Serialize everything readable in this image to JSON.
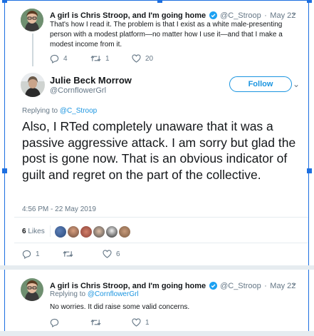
{
  "colors": {
    "accent": "#1b95e0",
    "verified": "#1da1f2",
    "selection": "#1d6fe0"
  },
  "tweet1": {
    "author": "A girl is Chris Stroop, and I'm going home",
    "handle": "@C_Stroop",
    "date": "May 22",
    "text": "That's how I read it. The problem is that I exist as a white male-presenting person with a modest platform—no matter how I use it—and that I make a modest income from it.",
    "replies": "4",
    "retweets": "1",
    "likes": "20"
  },
  "main": {
    "author": "Julie Beck Morrow",
    "handle": "@CornflowerGrl",
    "follow_label": "Follow",
    "replying_prefix": "Replying to",
    "replying_to": "@C_Stroop",
    "text": "Also, I RTed completely unaware that it was a passive aggressive attack. I am sorry but glad the post is gone now. That is an obvious indicator of guilt and regret on the part of the collective.",
    "timestamp": "4:56 PM - 22 May 2019",
    "likes_count": "6",
    "likes_label": "Likes",
    "replies": "1",
    "retweets": "",
    "like_count": "6"
  },
  "tweet3": {
    "author": "A girl is Chris Stroop, and I'm going home",
    "handle": "@C_Stroop",
    "date": "May 22",
    "replying_prefix": "Replying to",
    "replying_to": "@CornflowerGrl",
    "text": "No worries. It did raise some valid concerns.",
    "replies": "",
    "retweets": "",
    "likes": "1"
  }
}
